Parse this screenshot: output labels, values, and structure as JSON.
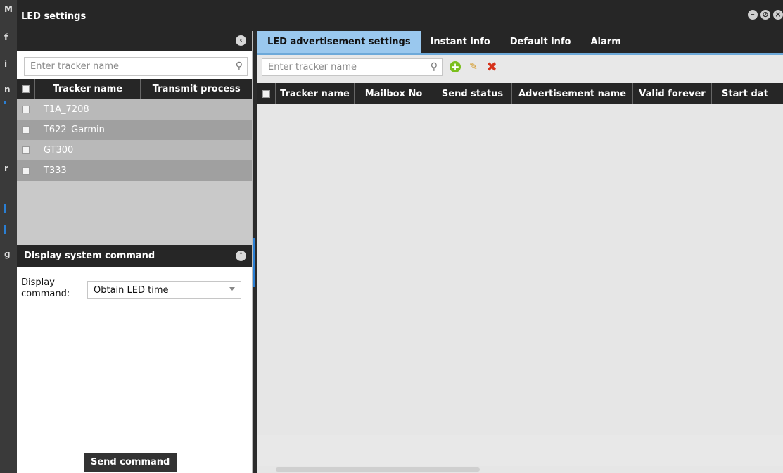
{
  "window": {
    "title": "LED settings"
  },
  "background_app": {
    "letters": [
      "M",
      "f",
      "i",
      "n",
      "r",
      "g"
    ]
  },
  "left_panel": {
    "search": {
      "placeholder": "Enter tracker name"
    },
    "columns": [
      "Tracker name",
      "Transmit process"
    ],
    "rows": [
      {
        "name": "T1A_7208",
        "process": ""
      },
      {
        "name": "T622_Garmin",
        "process": ""
      },
      {
        "name": "GT300",
        "process": ""
      },
      {
        "name": "T333",
        "process": ""
      }
    ]
  },
  "command_panel": {
    "header": "Display system command",
    "label": "Display command:",
    "selected": "Obtain LED time",
    "send_label": "Send command"
  },
  "right_panel": {
    "tabs": [
      "LED advertisement settings",
      "Instant info",
      "Default info",
      "Alarm"
    ],
    "active_tab": 0,
    "search": {
      "placeholder": "Enter tracker name"
    },
    "columns": [
      "Tracker name",
      "Mailbox No",
      "Send status",
      "Advertisement name",
      "Valid forever",
      "Start dat"
    ]
  },
  "colors": {
    "dark": "#262626",
    "active_tab": "#9ac8ee",
    "accent": "#2a7fd4",
    "add": "#7bbf1e",
    "delete": "#d6321a"
  },
  "icons": [
    "minimize-icon",
    "restore-icon",
    "close-icon",
    "collapse-left-icon",
    "collapse-up-icon",
    "search-icon",
    "add-icon",
    "edit-icon",
    "delete-icon",
    "dropdown-caret-icon"
  ]
}
